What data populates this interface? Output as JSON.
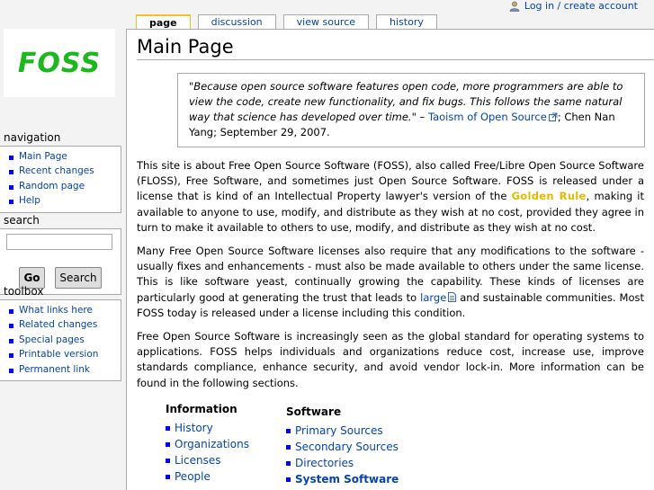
{
  "personal": {
    "login_label": "Log in / create account"
  },
  "tabs": [
    {
      "label": "page",
      "selected": true
    },
    {
      "label": "discussion",
      "selected": false
    },
    {
      "label": "view source",
      "selected": false
    },
    {
      "label": "history",
      "selected": false
    }
  ],
  "logo": {
    "text": "FOSS"
  },
  "navigation": {
    "heading": "navigation",
    "items": [
      "Main Page",
      "Recent changes",
      "Random page",
      "Help"
    ]
  },
  "search": {
    "heading": "search",
    "input_value": "",
    "go_label": "Go",
    "search_label": "Search"
  },
  "toolbox": {
    "heading": "toolbox",
    "items": [
      "What links here",
      "Related changes",
      "Special pages",
      "Printable version",
      "Permanent link"
    ]
  },
  "main": {
    "title": "Main Page",
    "quote": {
      "text": "\"Because open source software features open code, more programmers are able to view the code, create new functionality, and fix bugs. This follows the same natural way that science has developed over time.\"",
      "dash": " – ",
      "link": "Taoism of Open Source",
      "rest": "; Chen Nan Yang; September 29, 2007."
    },
    "p1": {
      "before": "This site is about Free Open Source Software (FOSS), also called Free/Libre Open Source Software (FLOSS), Free Software, and sometimes just Open Source Software. FOSS is released under a license that is kind of an Intellectual Property lawyer's version of the ",
      "link": "Golden Rule",
      "after": ", making it available to anyone to use, modify, and distribute as they wish at no cost, provided they agree in turn to make it available to others to use, modify, and distribute as they wish at no cost."
    },
    "p2": {
      "before": "Many Free Open Source Software licenses also require that any modifications to the software - usually fixes and enhancements - must also be made available to others under the same license. This is like software yeast, continually growing the capability. These kinds of licenses are particularly good at generating the trust that leads to ",
      "link": "large",
      "after": " and sustainable communities. Most FOSS today is released under a license including this condition."
    },
    "p3": "Free Open Source Software is increasingly seen as the global standard for operating systems to applications. FOSS helps individuals and organizations reduce cost, increase use, improve standards compliance, enhance security, and avoid vendor lock-in. More information can be found in the following sections.",
    "info_list": {
      "heading": "Information",
      "items": [
        "History",
        "Organizations",
        "Licenses",
        "People"
      ]
    },
    "software_list": {
      "heading": "Software",
      "items": [
        "Primary Sources",
        "Secondary Sources",
        "Directories",
        "System Software"
      ]
    }
  },
  "colors": {
    "link": "#0645ad",
    "golden_rule": "#e5b900",
    "logo": "#1fb71f",
    "selected_tab": "#fabd23"
  },
  "icons": [
    "user-icon",
    "external-link-icon",
    "document-icon"
  ]
}
